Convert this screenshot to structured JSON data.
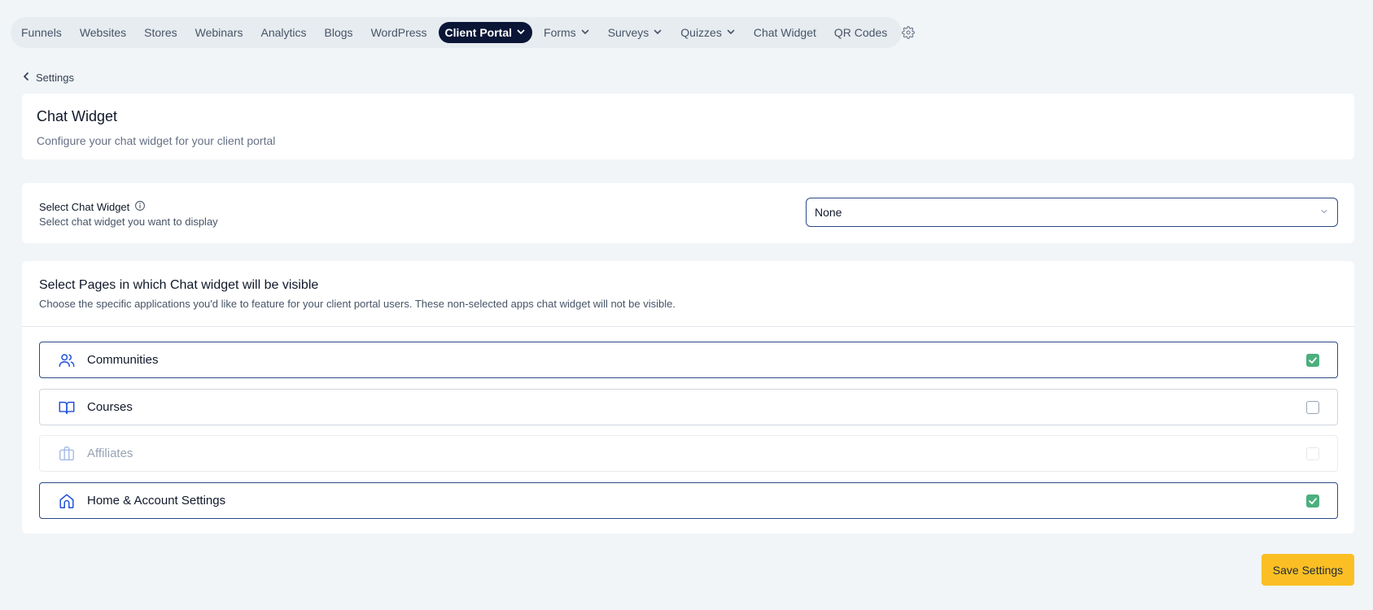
{
  "nav": {
    "items": [
      {
        "label": "Funnels"
      },
      {
        "label": "Websites"
      },
      {
        "label": "Stores"
      },
      {
        "label": "Webinars"
      },
      {
        "label": "Analytics"
      },
      {
        "label": "Blogs"
      },
      {
        "label": "WordPress"
      },
      {
        "label": "Client Portal",
        "active": true,
        "dropdown": true
      },
      {
        "label": "Forms",
        "dropdown": true
      },
      {
        "label": "Surveys",
        "dropdown": true
      },
      {
        "label": "Quizzes",
        "dropdown": true
      },
      {
        "label": "Chat Widget"
      },
      {
        "label": "QR Codes"
      }
    ],
    "settings_icon": "gear-icon"
  },
  "back": {
    "label": "Settings",
    "icon": "chevron-left-icon"
  },
  "header": {
    "title": "Chat Widget",
    "subtitle": "Configure your chat widget for your client portal"
  },
  "widget_select": {
    "label": "Select Chat Widget",
    "help": "Select chat widget you want to display",
    "value": "None",
    "info_icon": "info-icon"
  },
  "pages": {
    "title": "Select Pages in which Chat widget will be visible",
    "description": "Choose the specific applications you'd like to feature for your client portal users. These non-selected apps chat widget will not be visible.",
    "items": [
      {
        "label": "Communities",
        "icon": "users-icon",
        "checked": true,
        "disabled": false
      },
      {
        "label": "Courses",
        "icon": "book-open-icon",
        "checked": false,
        "disabled": false
      },
      {
        "label": "Affiliates",
        "icon": "briefcase-icon",
        "checked": false,
        "disabled": true
      },
      {
        "label": "Home & Account Settings",
        "icon": "home-icon",
        "checked": true,
        "disabled": false
      }
    ]
  },
  "save_label": "Save Settings",
  "colors": {
    "active_nav": "#0b1536",
    "accent_blue": "#1d4ed8",
    "checked_green": "#4caf7e",
    "save_button": "#fbbf24"
  }
}
